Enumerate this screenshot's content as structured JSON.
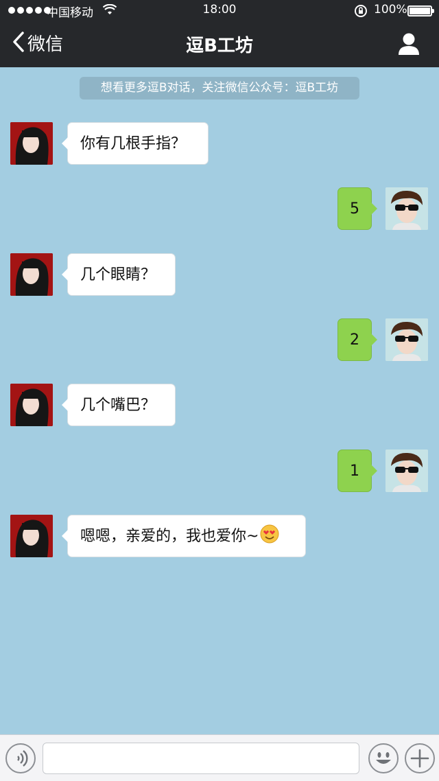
{
  "status_bar": {
    "carrier": "中国移动",
    "time": "18:00",
    "battery_text": "100%",
    "battery_level": 1.0,
    "signal_bars": 5
  },
  "nav": {
    "back_label": "微信",
    "title": "逗B工坊",
    "back_icon": "chevron-left-icon",
    "profile_icon": "person-icon"
  },
  "notice": "想看更多逗B对话，关注微信公众号：逗B工坊",
  "messages": [
    {
      "side": "incoming",
      "text": "你有几根手指？"
    },
    {
      "side": "outgoing",
      "text": "5"
    },
    {
      "side": "incoming",
      "text": "几个眼睛？"
    },
    {
      "side": "outgoing",
      "text": "2"
    },
    {
      "side": "incoming",
      "text": "几个嘴巴？"
    },
    {
      "side": "outgoing",
      "text": "1"
    },
    {
      "side": "incoming",
      "text": "嗯嗯，亲爱的，我也爱你~",
      "emoji": "heart-eyes-emoji"
    }
  ],
  "input_bar": {
    "voice_icon": "voice-icon",
    "emoji_icon": "smiley-icon",
    "add_icon": "plus-icon",
    "input_value": ""
  },
  "colors": {
    "chat_background": "#a3cde1",
    "top_bar": "#26282b",
    "outgoing_bubble": "#8ed24e",
    "incoming_bubble": "#ffffff"
  }
}
